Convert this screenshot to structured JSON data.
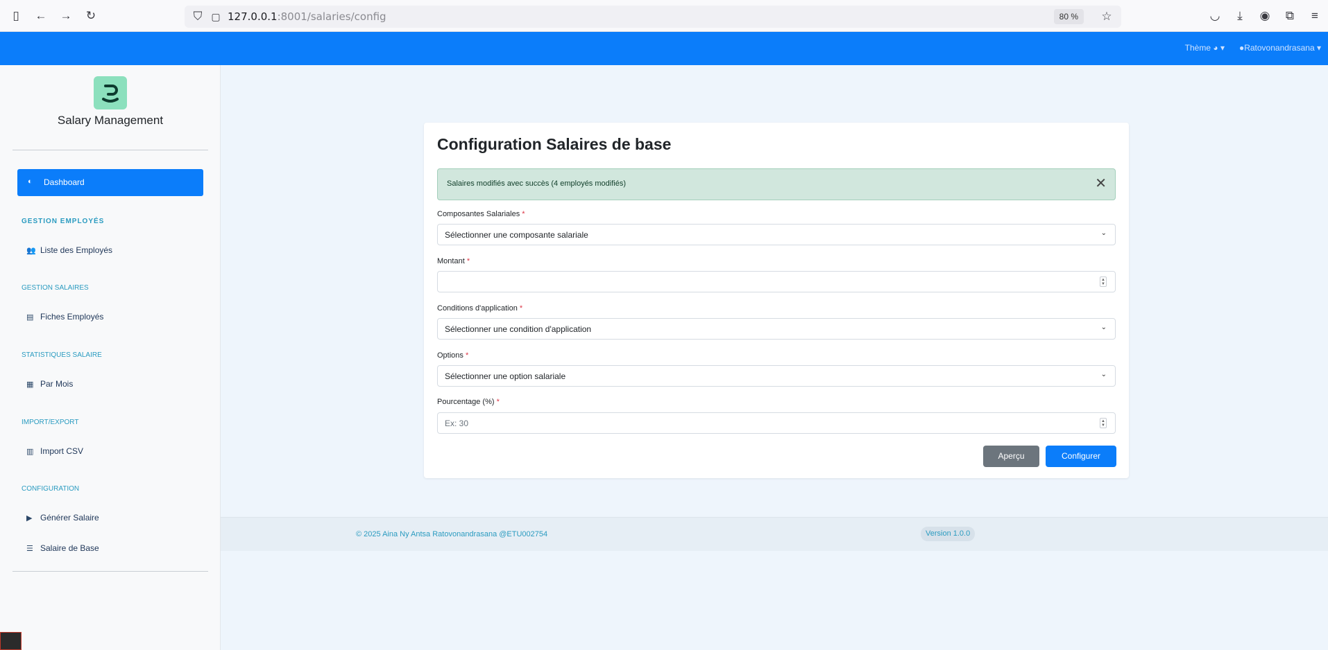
{
  "browser": {
    "url_host": "127.0.0.1",
    "url_rest": ":8001/salaries/config",
    "zoom": "80 %"
  },
  "topnav": {
    "theme": "Thème",
    "user": "Ratovonandrasana"
  },
  "sidebar": {
    "brand": "Salary Management",
    "active_item": "Dashboard",
    "sections": [
      {
        "title": "GESTION EMPLOYÉS",
        "items": [
          "Liste des Employés"
        ]
      },
      {
        "title": "GESTION SALAIRES",
        "items": [
          "Fiches Employés"
        ]
      },
      {
        "title": "STATISTIQUES SALAIRE",
        "items": [
          "Par Mois"
        ]
      },
      {
        "title": "IMPORT/EXPORT",
        "items": [
          "Import CSV"
        ]
      },
      {
        "title": "CONFIGURATION",
        "items": [
          "Générer Salaire",
          "Salaire de Base"
        ]
      }
    ]
  },
  "form": {
    "title": "Configuration Salaires de base",
    "alert": "Salaires modifiés avec succès (4 employés modifiés)",
    "required_mark": "*",
    "fields": [
      {
        "label": "Composantes Salariales",
        "value": "Sélectionner une composante salariale",
        "placeholder": ""
      },
      {
        "label": "Montant",
        "value": "",
        "placeholder": ""
      },
      {
        "label": "Conditions d'application",
        "value": "Sélectionner une condition d'application",
        "placeholder": ""
      },
      {
        "label": "Options",
        "value": "Sélectionner une option salariale",
        "placeholder": ""
      },
      {
        "label": "Pourcentage (%)",
        "value": "",
        "placeholder": "Ex: 30"
      }
    ],
    "buttons": {
      "preview": "Aperçu",
      "submit": "Configurer"
    }
  },
  "footer": {
    "copyright": "© 2025 Aina Ny Antsa Ratovonandrasana @ETU002754",
    "version": "Version 1.0.0"
  }
}
